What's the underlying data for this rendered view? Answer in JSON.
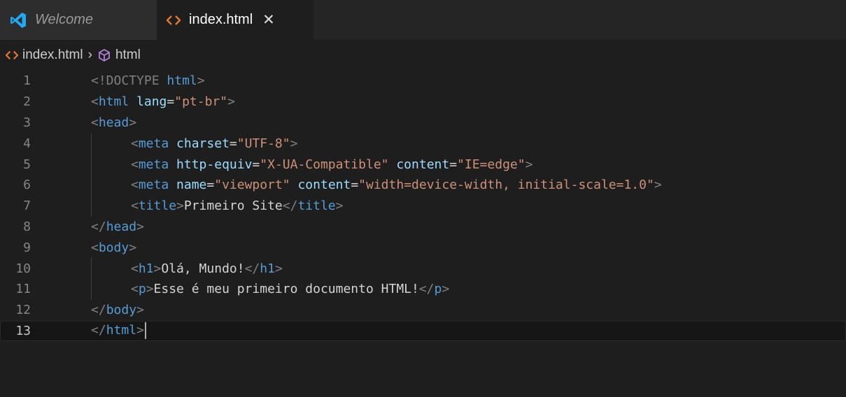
{
  "tabs": [
    {
      "label": "Welcome",
      "icon": "vscode-logo-icon",
      "active": false
    },
    {
      "label": "index.html",
      "icon": "html-file-icon",
      "active": true,
      "close": "✕"
    }
  ],
  "breadcrumb": {
    "file": "index.html",
    "separator": "›",
    "symbol": "html"
  },
  "editor": {
    "line_numbers": [
      "1",
      "2",
      "3",
      "4",
      "5",
      "6",
      "7",
      "8",
      "9",
      "10",
      "11",
      "12",
      "13"
    ],
    "active_line": "13",
    "lines": {
      "l1": [
        "<!DOCTYPE",
        " ",
        "html",
        ">"
      ],
      "l2": [
        "<",
        "html",
        " ",
        "lang",
        "=",
        "\"pt-br\"",
        ">"
      ],
      "l3": [
        "<",
        "head",
        ">"
      ],
      "l4": [
        "<",
        "meta",
        " ",
        "charset",
        "=",
        "\"UTF-8\"",
        ">"
      ],
      "l5": [
        "<",
        "meta",
        " ",
        "http-equiv",
        "=",
        "\"X-UA-Compatible\"",
        " ",
        "content",
        "=",
        "\"IE=edge\"",
        ">"
      ],
      "l6": [
        "<",
        "meta",
        " ",
        "name",
        "=",
        "\"viewport\"",
        " ",
        "content",
        "=",
        "\"width=device-width, initial-scale=1.0\"",
        ">"
      ],
      "l7": [
        "<",
        "title",
        ">",
        "Primeiro Site",
        "</",
        "title",
        ">"
      ],
      "l8": [
        "</",
        "head",
        ">"
      ],
      "l9": [
        "<",
        "body",
        ">"
      ],
      "l10": [
        "<",
        "h1",
        ">",
        "Olá, Mundo!",
        "</",
        "h1",
        ">"
      ],
      "l11": [
        "<",
        "p",
        ">",
        "Esse é meu primeiro documento HTML!",
        "</",
        "p",
        ">"
      ],
      "l12": [
        "</",
        "body",
        ">"
      ],
      "l13": [
        "</",
        "html",
        ">"
      ]
    }
  },
  "colors": {
    "background": "#1e1e1e",
    "tag": "#569cd6",
    "attribute": "#9cdcfe",
    "string": "#ce9178",
    "punctuation": "#808080",
    "text": "#d4d4d4"
  }
}
